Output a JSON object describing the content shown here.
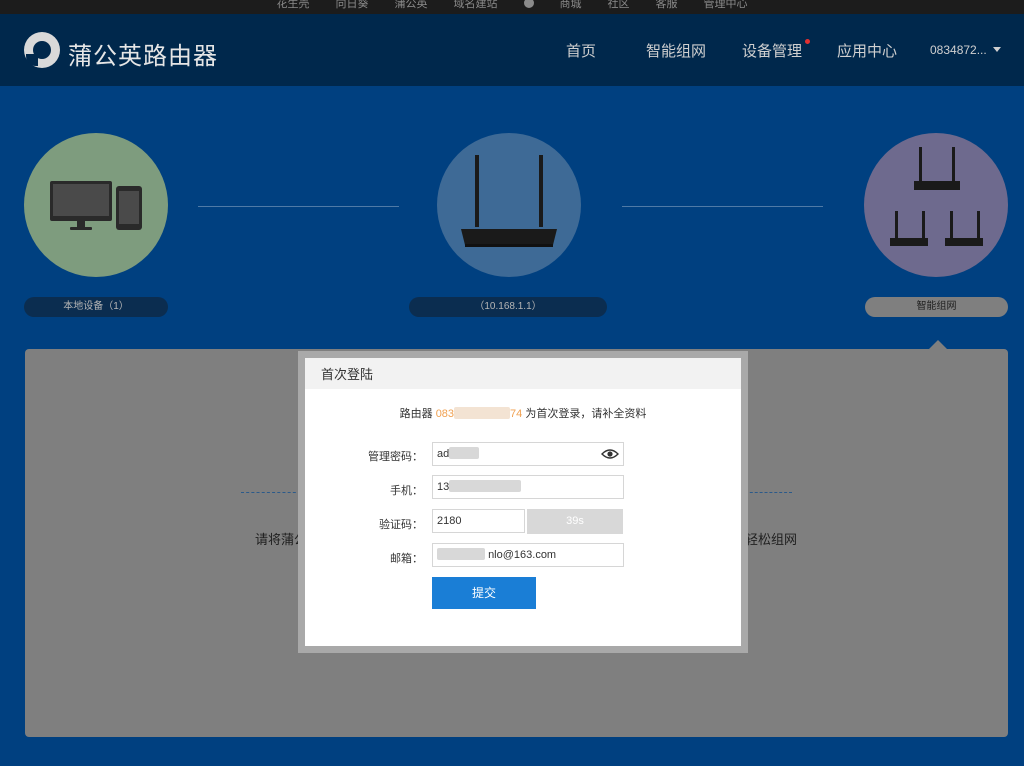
{
  "topbar": {
    "links": [
      "花生壳",
      "向日葵",
      "蒲公英",
      "域名建站",
      "商城",
      "社区",
      "客服",
      "管理中心"
    ]
  },
  "header": {
    "brand": "蒲公英路由器",
    "nav": {
      "home": "首页",
      "mesh": "智能组网",
      "devices": "设备管理",
      "apps": "应用中心"
    },
    "user": "0834872..."
  },
  "topology": {
    "local_label": "本地设备（1）",
    "router_label": "（10.168.1.1）",
    "mesh_label": "智能组网"
  },
  "panel": {
    "text_left": "请将蒲公",
    "text_right": "轻松组网"
  },
  "modal": {
    "title": "首次登陆",
    "notice_prefix": "路由器",
    "router_id_start": "083",
    "router_id_end": "74",
    "notice_suffix": "为首次登录，请补全资料",
    "password_label": "管理密码：",
    "password_value": "ad",
    "phone_label": "手机：",
    "phone_value": "13",
    "code_label": "验证码：",
    "code_value": "2180",
    "code_button": "39s",
    "email_label": "邮箱：",
    "email_value": "nlo@163.com",
    "submit": "提交"
  }
}
